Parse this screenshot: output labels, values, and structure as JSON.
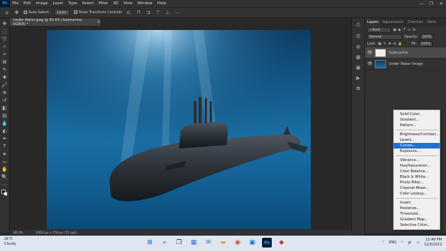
{
  "app": {
    "logo": "Ps",
    "menu": [
      "File",
      "Edit",
      "Image",
      "Layer",
      "Type",
      "Select",
      "Filter",
      "3D",
      "View",
      "Window",
      "Help"
    ],
    "window_controls": [
      "—",
      "❐",
      "✕"
    ]
  },
  "options_bar": {
    "auto_select_label": "Auto-Select:",
    "auto_select_value": "Layer",
    "show_transform_label": "Show Transform Controls"
  },
  "document": {
    "tab_title": "Under Water.jpeg @ 80.4% (Submarine, RGB/8) *",
    "zoom": "80.4%",
    "doc_info": "1000 px x 750 px (72 ppi)"
  },
  "layers_panel": {
    "tabs": [
      "Layers",
      "Adjustments",
      "Channels",
      "Paths"
    ],
    "kind_label": "Kind",
    "blend_mode": "Normal",
    "opacity_label": "Opacity:",
    "opacity_value": "100%",
    "lock_label": "Lock:",
    "fill_label": "Fill:",
    "fill_value": "100%",
    "layers": [
      {
        "name": "Submarine",
        "selected": true
      },
      {
        "name": "Under Water Image",
        "selected": false
      }
    ]
  },
  "adjustment_menu": {
    "groups": [
      [
        "Solid Color...",
        "Gradient...",
        "Pattern..."
      ],
      [
        "Brightness/Contrast...",
        "Levels...",
        "Curves...",
        "Exposure..."
      ],
      [
        "Vibrance...",
        "Hue/Saturation...",
        "Color Balance...",
        "Black & White...",
        "Photo Filter...",
        "Channel Mixer...",
        "Color Lookup..."
      ],
      [
        "Invert",
        "Posterize...",
        "Threshold...",
        "Gradient Map...",
        "Selective Color..."
      ]
    ],
    "highlighted": "Curves..."
  },
  "taskbar": {
    "weather_temp": "26°C",
    "weather_desc": "Cloudy",
    "language": "ENG",
    "time": "11:49 PM",
    "date": "11/3/2022"
  },
  "colors": {
    "accent": "#1f6fd6",
    "ps_blue": "#31a8ff"
  }
}
